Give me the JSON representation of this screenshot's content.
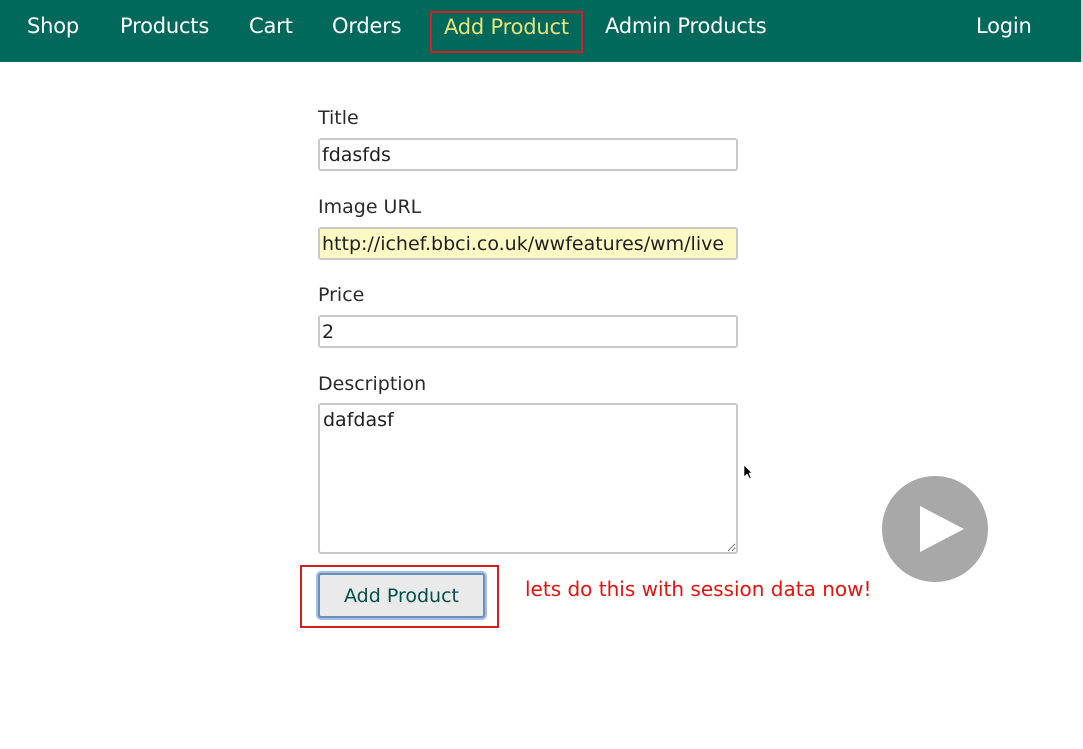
{
  "nav": {
    "items": [
      {
        "label": "Shop"
      },
      {
        "label": "Products"
      },
      {
        "label": "Cart"
      },
      {
        "label": "Orders"
      },
      {
        "label": "Add Product"
      },
      {
        "label": "Admin Products"
      }
    ],
    "login_label": "Login",
    "active_item": "Add Product"
  },
  "form": {
    "title": {
      "label": "Title",
      "value": "fdasfds"
    },
    "image_url": {
      "label": "Image URL",
      "value": "http://ichef.bbci.co.uk/wwfeatures/wm/live"
    },
    "price": {
      "label": "Price",
      "value": "2"
    },
    "description": {
      "label": "Description",
      "value": "dafdasf"
    },
    "submit_label": "Add Product"
  },
  "overlay": {
    "annotation_text": "lets do this with session data now!",
    "play_icon": "play-icon"
  },
  "colors": {
    "header_bg": "#00695c",
    "active_nav_text": "#e9e27a",
    "highlight_red": "#d51f1f",
    "autofill_bg": "#fdf9c4",
    "annotation_red": "#e3130f"
  }
}
